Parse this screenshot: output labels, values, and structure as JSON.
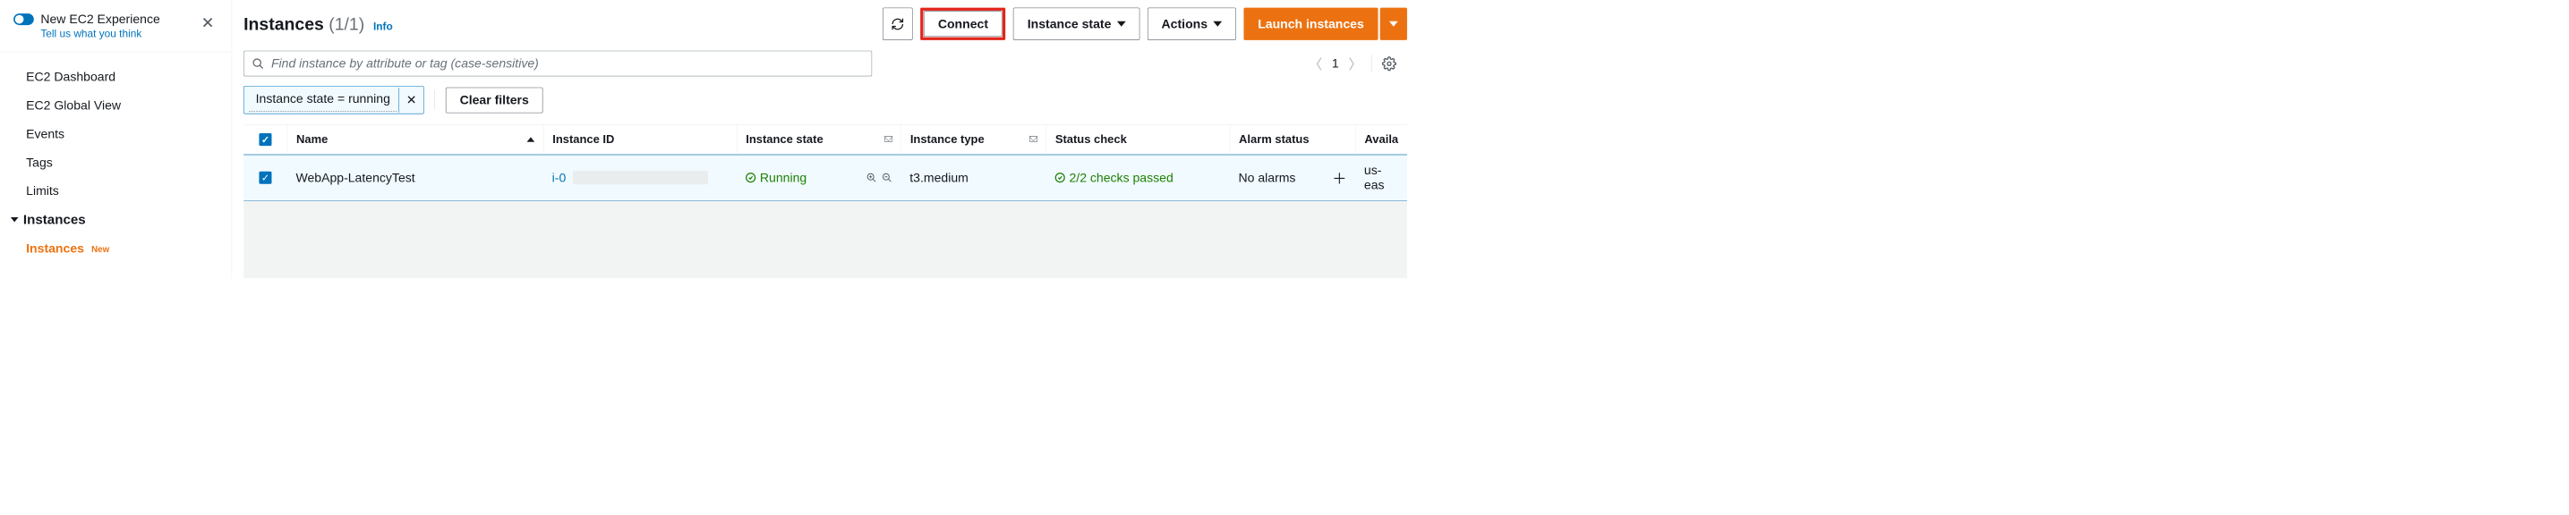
{
  "sidebar": {
    "experience": {
      "title": "New EC2 Experience",
      "subtitle": "Tell us what you think"
    },
    "items": [
      "EC2 Dashboard",
      "EC2 Global View",
      "Events",
      "Tags",
      "Limits"
    ],
    "section": "Instances",
    "active": {
      "label": "Instances",
      "badge": "New"
    }
  },
  "header": {
    "title": "Instances",
    "count": "(1/1)",
    "info": "Info",
    "connect": "Connect",
    "instance_state": "Instance state",
    "actions": "Actions",
    "launch": "Launch instances"
  },
  "search": {
    "placeholder": "Find instance by attribute or tag (case-sensitive)"
  },
  "pager": {
    "page": "1"
  },
  "filters": {
    "chip": "Instance state = running",
    "clear": "Clear filters"
  },
  "columns": [
    "Name",
    "Instance ID",
    "Instance state",
    "Instance type",
    "Status check",
    "Alarm status",
    "Availa"
  ],
  "row": {
    "name": "WebApp-LatencyTest",
    "instance_id": "i-0",
    "state": "Running",
    "type": "t3.medium",
    "status": "2/2 checks passed",
    "alarm": "No alarms",
    "az": "us-eas"
  }
}
